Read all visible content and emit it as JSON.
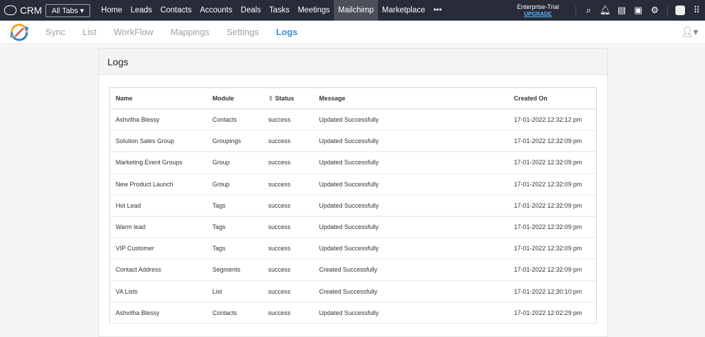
{
  "topbar": {
    "brand": "CRM",
    "all_tabs": "All Tabs ▾",
    "nav": [
      "Home",
      "Leads",
      "Contacts",
      "Accounts",
      "Deals",
      "Tasks",
      "Meetings",
      "Mailchimp",
      "Marketplace",
      "•••"
    ],
    "active": "Mailchimp",
    "plan": "Enterprise-Trial",
    "upgrade": "UPGRADE",
    "icons": [
      "search-icon",
      "bell-icon",
      "add-note-icon",
      "calendar-icon",
      "gear-icon",
      "avatar",
      "apps-grid-icon"
    ]
  },
  "subnav": {
    "items": [
      "Sync",
      "List",
      "WorkFlow",
      "Mappings",
      "Settings",
      "Logs"
    ],
    "active": "Logs"
  },
  "logs": {
    "title": "Logs",
    "columns": [
      "Name",
      "Module",
      "Status",
      "Message",
      "Created On"
    ],
    "rows": [
      [
        "Ashvitha Blessy",
        "Contacts",
        "success",
        "Updated Successfully",
        "17-01-2022 12:32:12 pm"
      ],
      [
        "Solution Sales Group",
        "Groupings",
        "success",
        "Updated Successfully",
        "17-01-2022 12:32:09 pm"
      ],
      [
        "Marketing Event Groups",
        "Group",
        "success",
        "Updated Successfully",
        "17-01-2022 12:32:09 pm"
      ],
      [
        "New Product Launch",
        "Group",
        "success",
        "Updated Successfully",
        "17-01-2022 12:32:09 pm"
      ],
      [
        "Hot Lead",
        "Tags",
        "success",
        "Updated Successfully",
        "17-01-2022 12:32:09 pm"
      ],
      [
        "Warm lead",
        "Tags",
        "success",
        "Updated Successfully",
        "17-01-2022 12:32:09 pm"
      ],
      [
        "VIP Customer",
        "Tags",
        "success",
        "Updated Successfully",
        "17-01-2022 12:32:09 pm"
      ],
      [
        "Contact Address",
        "Segments",
        "success",
        "Created Successfully",
        "17-01-2022 12:32:09 pm"
      ],
      [
        "VA Lists",
        "List",
        "success",
        "Created Successfully",
        "17-01-2022 12:30:10 pm"
      ],
      [
        "Ashvitha Blessy",
        "Contacts",
        "success",
        "Updated Successfully",
        "17-01-2022 12:02:29 pm"
      ]
    ]
  }
}
